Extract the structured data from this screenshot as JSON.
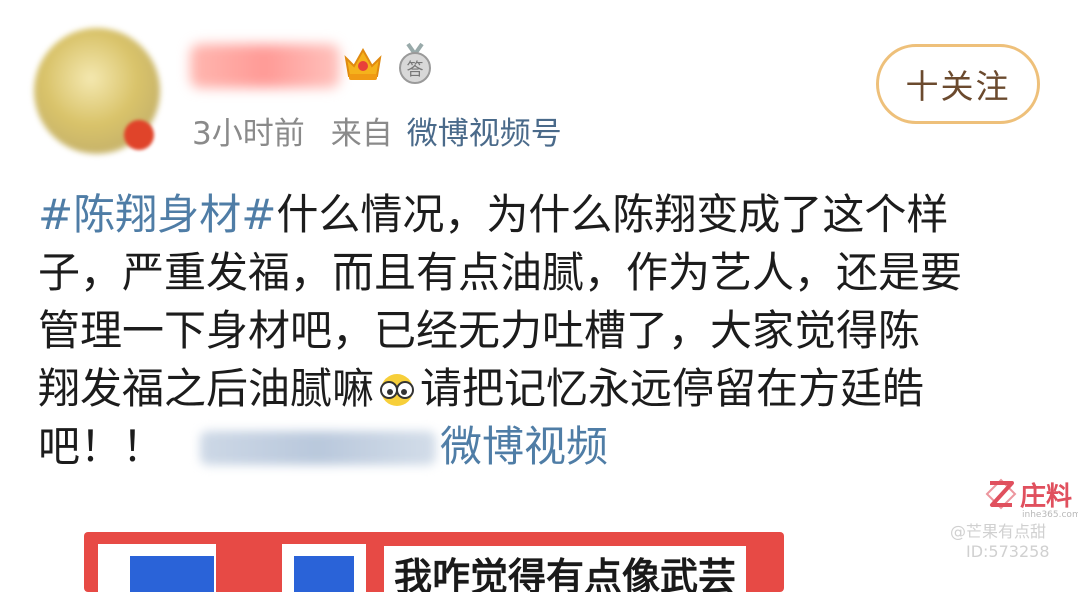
{
  "post": {
    "meta": {
      "time": "3小时前",
      "from": "来自",
      "source": "微博视频号"
    },
    "follow_label": "十关注",
    "content": {
      "hashtag": "#陈翔身材#",
      "line1_rest": "什么情况，为什么陈翔变成了这个样",
      "line2": "子，严重发福，而且有点油腻，作为艺人，还是要",
      "line3": "管理一下身材吧，已经无力吐槽了，大家觉得陈",
      "line4_pre": "翔发福之后油腻嘛",
      "line4_post": "请把记忆永远停留在方廷皓",
      "line5": "吧！！",
      "video_link": "微博视频"
    },
    "video": {
      "caption": "我咋觉得有点像武芸"
    }
  },
  "watermark": {
    "brand": "庄料",
    "sub": "inhe365.com",
    "line1": "@芒果有点甜",
    "line2": "ID:573258"
  },
  "colors": {
    "link": "#4f7da6",
    "follow_border": "#eec07a",
    "video_bg": "#e74a45"
  },
  "icons": [
    "crown-icon",
    "medal-icon",
    "glasses-emoji-icon",
    "watermark-z-icon"
  ]
}
